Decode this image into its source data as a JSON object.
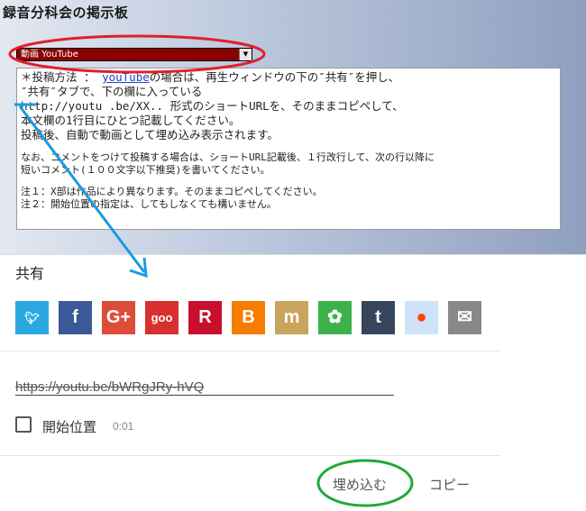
{
  "forum": {
    "title": "録音分科会の掲示板",
    "category_select": {
      "selected": "動画 YouTube"
    },
    "instructions": {
      "line1_prefix": "＊投稿方法 ： ",
      "line1_link": "youTube",
      "line1_suffix": "の場合は、再生ウィンドウの下の″共有″を押し、",
      "line2": "″共有″タブで、下の欄に入っている",
      "line3": "http://youtu .be/XX.. 形式のショートURLを、そのままコピペして、",
      "line4": "本文欄の1行目にひとつ記載してください。",
      "line5": "投稿後、自動で動画として埋め込み表示されます。",
      "line6": "なお、コメントをつけて投稿する場合は、ショートURL記載後、１行改行して、次の行以降に",
      "line7": "短いコメント(１００文字以下推奨)を書いてください。",
      "line8": "注１：X部は作品により異なります。そのままコピペしてください。",
      "line9": "注２：開始位置の指定は、してもしなくても構いません。"
    }
  },
  "share": {
    "title": "共有",
    "icons": [
      {
        "name": "twitter-icon",
        "glyph": "🐦︎",
        "color": "#2aa9e0"
      },
      {
        "name": "facebook-icon",
        "glyph": "f",
        "color": "#3b5998"
      },
      {
        "name": "google-plus-icon",
        "glyph": "G+",
        "color": "#dd4b39"
      },
      {
        "name": "goo-icon",
        "glyph": "goo",
        "color": "#d7302e"
      },
      {
        "name": "rakuten-icon",
        "glyph": "R",
        "color": "#c8102e"
      },
      {
        "name": "blogger-icon",
        "glyph": "B",
        "color": "#f57d00"
      },
      {
        "name": "mixi-icon",
        "glyph": "m",
        "color": "#c9a45c"
      },
      {
        "name": "ameba-icon",
        "glyph": "✿",
        "color": "#3cb34a"
      },
      {
        "name": "tumblr-icon",
        "glyph": "t",
        "color": "#35465c"
      },
      {
        "name": "reddit-icon",
        "glyph": "●",
        "color": "#cee3f8"
      },
      {
        "name": "email-icon",
        "glyph": "✉",
        "color": "#888888"
      }
    ],
    "url_value": "https://youtu.be/bWRgJRy-hVQ",
    "start_label": "開始位置",
    "start_time": "0:01",
    "embed_label": "埋め込む",
    "copy_label": "コピー"
  },
  "annotations": {
    "red_ellipse_color": "#e0202a",
    "green_ellipse_color": "#22a83a",
    "arrow_color": "#1a9be0"
  }
}
